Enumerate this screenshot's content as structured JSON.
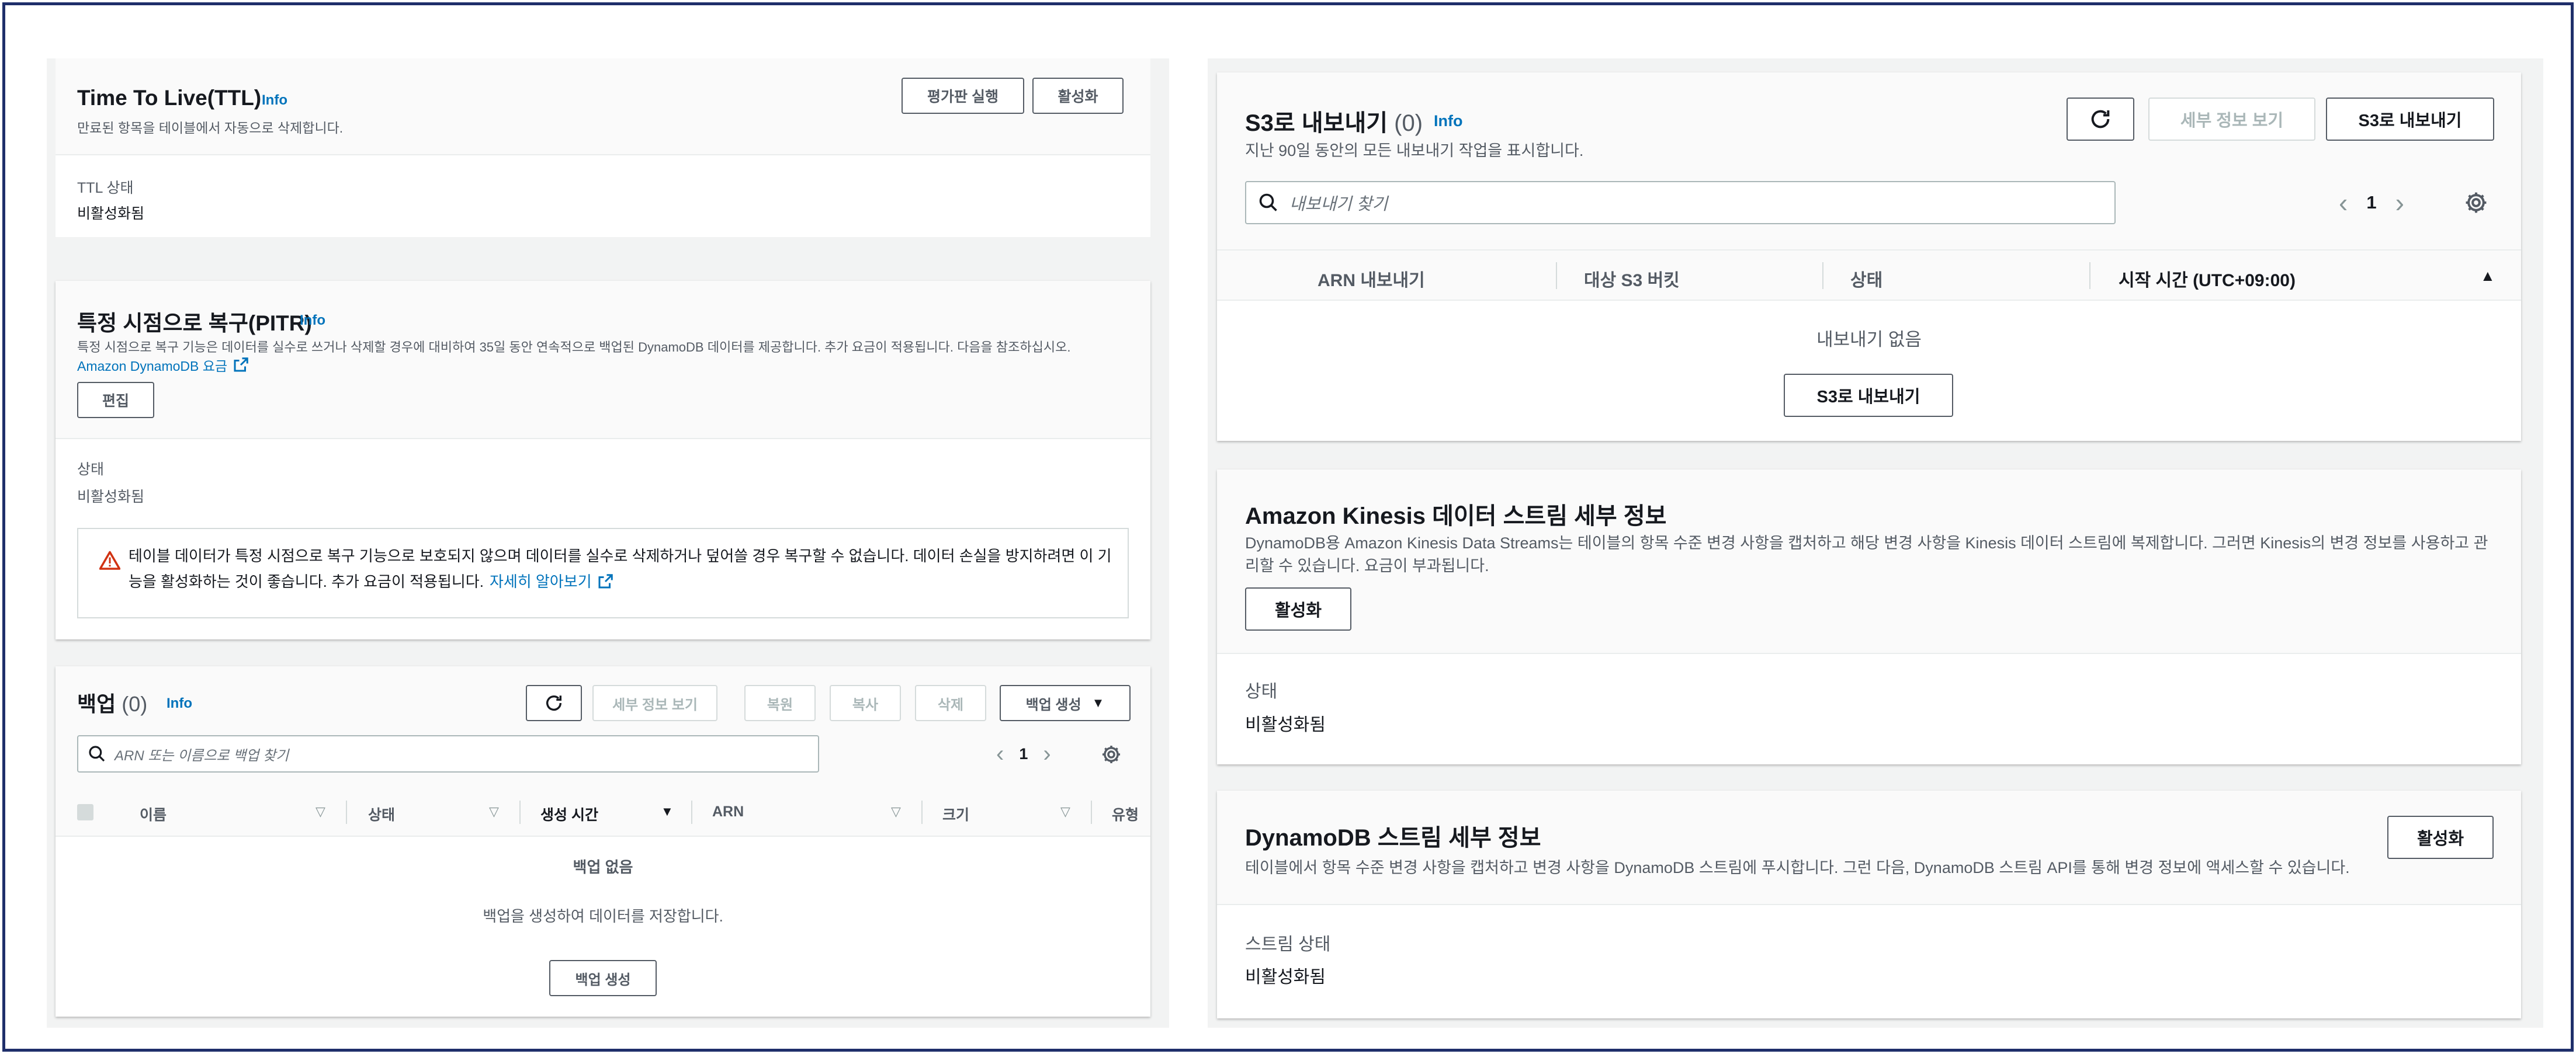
{
  "ttl": {
    "title": "Time To Live(TTL)",
    "info": "Info",
    "desc": "만료된 항목을 테이블에서 자동으로 삭제합니다.",
    "btn_preview": "평가판 실행",
    "btn_enable": "활성화",
    "status_label": "TTL 상태",
    "status_value": "비활성화됨"
  },
  "pitr": {
    "title": "특정 시점으로 복구(PITR)",
    "info": "Info",
    "desc": "특정 시점으로 복구 기능은 데이터를 실수로 쓰거나 삭제할 경우에 대비하여 35일 동안 연속적으로 백업된 DynamoDB 데이터를 제공합니다. 추가 요금이 적용됩니다. 다음을 참조하십시오.",
    "pricing_link": "Amazon DynamoDB 요금",
    "btn_edit": "편집",
    "status_label": "상태",
    "status_value": "비활성화됨",
    "alert_line1": "테이블 데이터가 특정 시점으로 복구 기능으로 보호되지 않으며 데이터를 실수로 삭제하거나 덮어쓸 경우 복구할 수 없습니다. 데이터 손실을 방지하려면 이 기",
    "alert_line2": "능을 활성화하는 것이 좋습니다. 추가 요금이 적용됩니다.",
    "alert_link": "자세히 알아보기"
  },
  "backup": {
    "title": "백업",
    "count": "(0)",
    "info": "Info",
    "btn_details": "세부 정보 보기",
    "btn_restore": "복원",
    "btn_copy": "복사",
    "btn_delete": "삭제",
    "btn_create": "백업 생성",
    "search_placeholder": "ARN 또는 이름으로 백업 찾기",
    "page": "1",
    "columns": [
      "이름",
      "상태",
      "생성 시간",
      "ARN",
      "크기",
      "유형"
    ],
    "empty_title": "백업 없음",
    "empty_sub": "백업을 생성하여 데이터를 저장합니다.",
    "empty_btn": "백업 생성"
  },
  "s3export": {
    "title": "S3로 내보내기",
    "count": "(0)",
    "info": "Info",
    "desc": "지난 90일 동안의 모든 내보내기 작업을 표시합니다.",
    "btn_details": "세부 정보 보기",
    "btn_export": "S3로 내보내기",
    "search_placeholder": "내보내기 찾기",
    "page": "1",
    "columns": [
      "ARN 내보내기",
      "대상 S3 버킷",
      "상태",
      "시작 시간 (UTC+09:00)"
    ],
    "empty_title": "내보내기 없음",
    "empty_btn": "S3로 내보내기"
  },
  "kinesis": {
    "title": "Amazon Kinesis 데이터 스트림 세부 정보",
    "desc_line1": "DynamoDB용 Amazon Kinesis Data Streams는 테이블의 항목 수준 변경 사항을 캡처하고 해당 변경 사항을 Kinesis 데이터 스트림에 복제합니다. 그러면 Kinesis의 변경 정보를 사용하고 관",
    "desc_line2": "리할 수 있습니다. 요금이 부과됩니다.",
    "btn_enable": "활성화",
    "status_label": "상태",
    "status_value": "비활성화됨"
  },
  "streams": {
    "title": "DynamoDB 스트림 세부 정보",
    "desc": "테이블에서 항목 수준 변경 사항을 캡처하고 변경 사항을 DynamoDB 스트림에 푸시합니다. 그런 다음, DynamoDB 스트림 API를 통해 변경 정보에 액세스할 수 있습니다.",
    "btn_enable": "활성화",
    "status_label": "스트림 상태",
    "status_value": "비활성화됨"
  },
  "icons": [
    "refresh-icon",
    "search-icon",
    "settings-icon",
    "external-link-icon",
    "warning-icon",
    "chevron-left-icon",
    "chevron-right-icon",
    "sort-icon",
    "dropdown-caret-icon"
  ],
  "colors": {
    "link": "#0073bb",
    "warning": "#d13212",
    "border_dark": "#545b64",
    "muted": "#879596"
  }
}
